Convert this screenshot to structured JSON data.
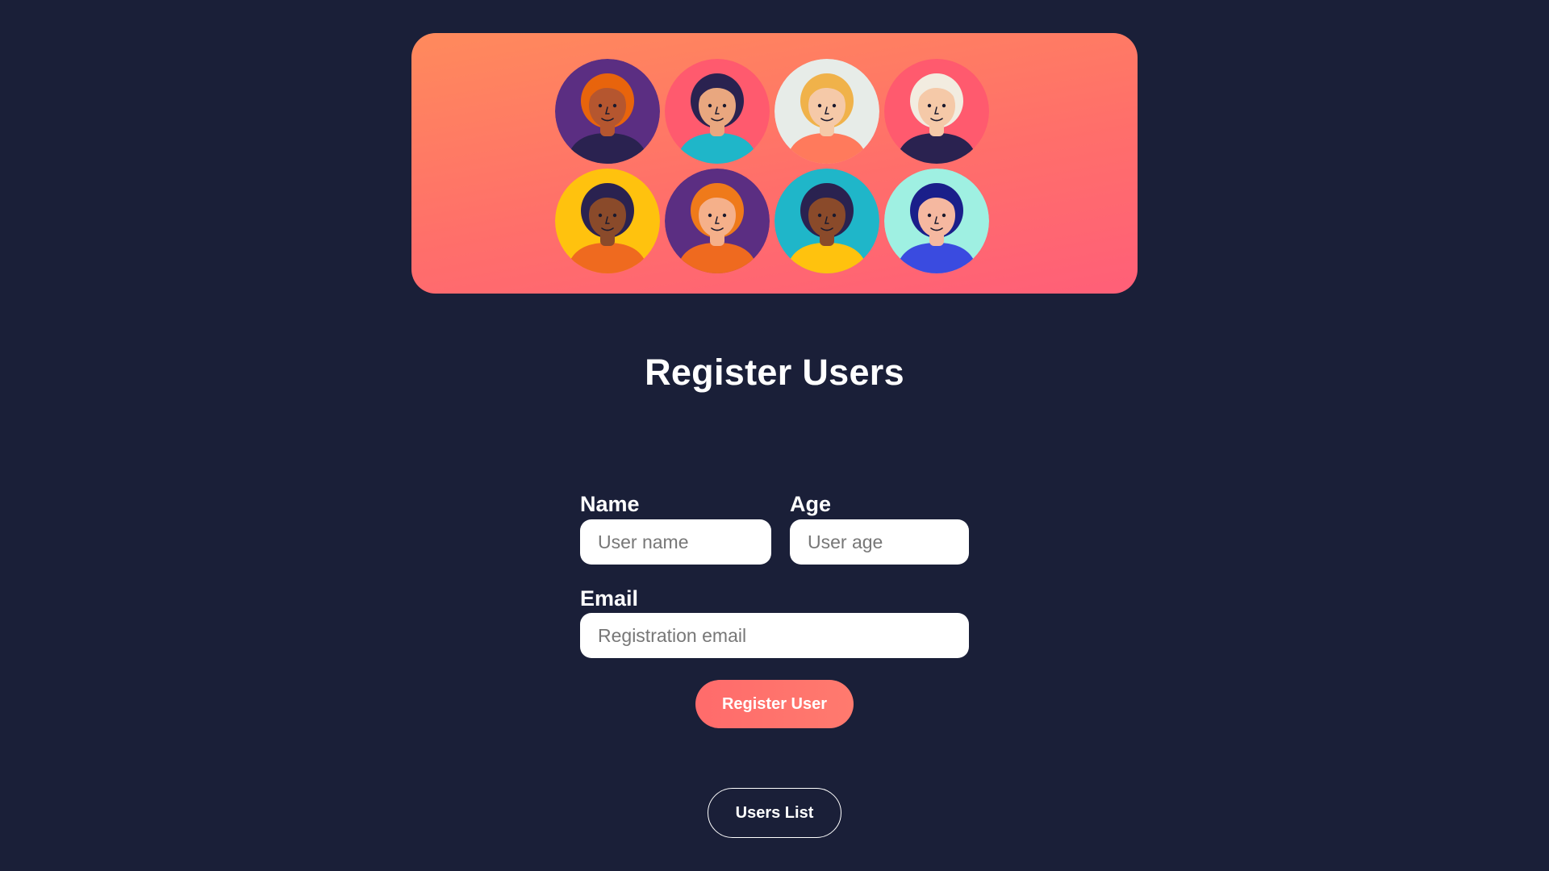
{
  "banner": {
    "avatars": [
      {
        "name": "woman-curly-orange-hair",
        "bg": "#5b2e82",
        "skin": "#b5562f",
        "hair": "#e8640c",
        "shirt": "#2a2250"
      },
      {
        "name": "woman-teal-cap",
        "bg": "#ff5a6e",
        "skin": "#e9a77f",
        "hair": "#2a2250",
        "shirt": "#1fb6c9"
      },
      {
        "name": "woman-blonde-ponytail",
        "bg": "#e7ece8",
        "skin": "#f5c9a8",
        "hair": "#f0b24a",
        "shirt": "#ff7a5c"
      },
      {
        "name": "man-white-hair",
        "bg": "#ff5a6e",
        "skin": "#f5c9a8",
        "hair": "#f2ece0",
        "shirt": "#2a2250"
      },
      {
        "name": "man-glasses",
        "bg": "#ffc20e",
        "skin": "#8a4a2a",
        "hair": "#2a2250",
        "shirt": "#ef6a1f"
      },
      {
        "name": "man-ginger-hair",
        "bg": "#5b2e82",
        "skin": "#f5b08a",
        "hair": "#ef7a1a",
        "shirt": "#ef6a1f"
      },
      {
        "name": "man-yellow-jacket",
        "bg": "#1fb6c9",
        "skin": "#8a4a2a",
        "hair": "#2a2250",
        "shirt": "#ffc20e"
      },
      {
        "name": "man-beard-blue",
        "bg": "#9ff0e2",
        "skin": "#f5b8a0",
        "hair": "#1a1f8a",
        "shirt": "#3a4be0"
      }
    ]
  },
  "title": "Register Users",
  "form": {
    "name": {
      "label": "Name",
      "placeholder": "User name",
      "value": ""
    },
    "age": {
      "label": "Age",
      "placeholder": "User age",
      "value": ""
    },
    "email": {
      "label": "Email",
      "placeholder": "Registration email",
      "value": ""
    },
    "submit_label": "Register User"
  },
  "users_list_label": "Users List",
  "colors": {
    "background": "#1a1f38",
    "accent": "#ff6b6b",
    "banner_gradient_start": "#ff8a5c",
    "banner_gradient_end": "#ff5f78"
  }
}
